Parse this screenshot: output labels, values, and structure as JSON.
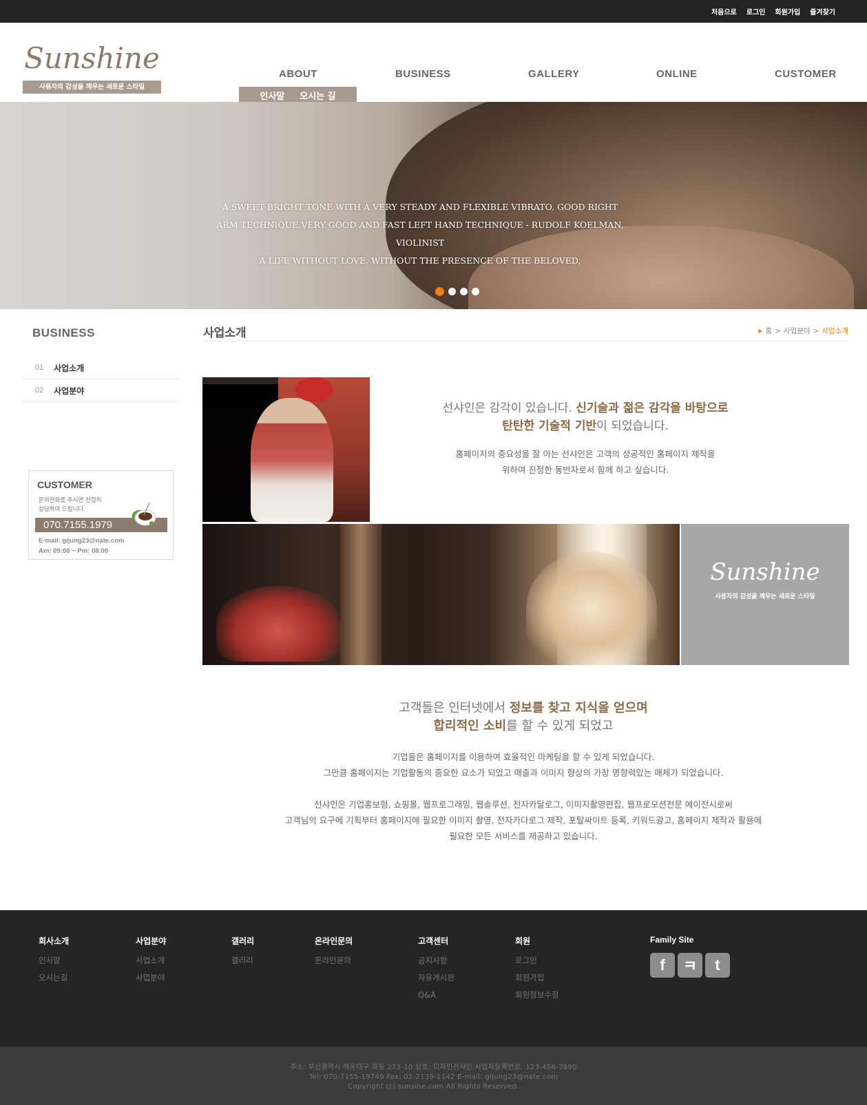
{
  "utility_links": [
    "처음으로",
    "로그인",
    "회원가입",
    "즐겨찾기"
  ],
  "logo": {
    "word": "Sunshine",
    "tagline": "사용자의 감성을 깨우는 새로운 스타일"
  },
  "gnb": {
    "about": "ABOUT",
    "business": "BUSINESS",
    "gallery": "GALLERY",
    "online": "ONLINE",
    "customer": "CUSTOMER"
  },
  "subnav": [
    "인사말",
    "오시는 길"
  ],
  "hero": {
    "lines": [
      "A SWEET BRIGHT TONE WITH A VERY STEADY AND FLEXIBLE VIBRATO, GOOD RIGHT",
      "ARM TECHNIQUE,VERY GOOD AND FAST LEFT HAND TECHNIQUE - RUDOLF KOELMAN, VIOLINIST",
      "A LIFE WITHOUT LOVE, WITHOUT THE PRESENCE OF THE BELOVED,"
    ],
    "slide_count": 4,
    "active_slide": 1
  },
  "sidebar": {
    "title": "BUSINESS",
    "items": [
      {
        "num": "01",
        "label": "사업소개"
      },
      {
        "num": "02",
        "label": "사업분야"
      }
    ]
  },
  "customer_box": {
    "title": "CUSTOMER",
    "desc_1": "문의전화를 주시면 친절히",
    "desc_2": "상담하여 드립니다.",
    "phone": "070.7155.1979",
    "email": "E-mail: gijung23@nate.com",
    "hours": "Am: 09:00 ~ Pm: 08:00"
  },
  "content": {
    "title": "사업소개",
    "breadcrumb": {
      "home": "홈",
      "sep": ">",
      "parent": "사업분야",
      "current": "사업소개"
    },
    "block_a": {
      "head_1_plain": "선샤인은 감각이 있습니다. ",
      "head_1_accent": "신기술과 젊은 감각을 바탕으로",
      "head_2_accent": "탄탄한 기술적 기반",
      "head_2_plain": "이 되었습니다.",
      "body_1": "홈페이지의 중요성을 잘 아는 선샤인은 고객의 성공적인 홈페이지 제작을",
      "body_2": "위하여 진정한 동반자로서 함께 하고 싶습니다."
    },
    "brand_box": {
      "word": "Sunshine",
      "tagline": "사용자의 감성을 깨우는 새로운 스타일"
    },
    "block_b": {
      "head_1_plain": "고객들은 인터넷에서 ",
      "head_1_accent": "정보를 찾고 지식을 얻으며",
      "head_2_accent": "합리적인 소비",
      "head_2_plain": "를 할 수 있게 되었고",
      "body_1": "기업들은 홈페이지를 이용하여 효율적인 마케팅을 할 수 있게 되었습니다.",
      "body_2": "그만큼 홈페이지는 기업활동의 중요한 요소가 되었고 매출과 이미지 향상의 가장 영향력있는 매체가 되었습니다.",
      "body_3": "선샤인은 기업홍보형, 쇼핑몰, 웹프로그래밍, 웹솔루션, 전자카달로그, 이미지촬영편집, 웹프로모션전문 에이전시로써",
      "body_4": "고객님의 요구에 기획부터 홈페이지에 필요한 이미지 촬영, 전자카다로그 제작, 포탈싸이트 등록, 키워드광고, 홈페이지 제작과 활용에",
      "body_5": "필요한 모든 서비스를 제공하고 있습니다."
    }
  },
  "footer": {
    "cols": [
      {
        "head": "회사소개",
        "links": [
          "인사말",
          "오시는길"
        ]
      },
      {
        "head": "사업분야",
        "links": [
          "사업소개",
          "사업분야"
        ]
      },
      {
        "head": "갤러리",
        "links": [
          "갤러리"
        ]
      },
      {
        "head": "온라인문의",
        "links": [
          "온라인문의"
        ]
      },
      {
        "head": "고객센터",
        "links": [
          "공지사항",
          "자유게시판",
          "Q&A"
        ]
      },
      {
        "head": "회원",
        "links": [
          "로그인",
          "회원가입",
          "회원정보수정"
        ]
      }
    ],
    "family_site": "Family Site",
    "sns": [
      {
        "icon": "facebook-icon",
        "glyph": "f"
      },
      {
        "icon": "cyworld-icon",
        "glyph": "ㅋ"
      },
      {
        "icon": "twitter-icon",
        "glyph": "t"
      }
    ],
    "address": "주소: 부산광역시 해운대구 좌동 273-10  상호: 디자인선샤인  사업자등록번호: 123-456-7890",
    "contact": "Tel: 070-7155-19749  Fax: 02-2139-1142  E-mail: gijung23@nate.com",
    "copyright": "Copyright (c) sunsine.com All Rights Reserved."
  },
  "colors": {
    "accent": "#f07d1a",
    "brand": "#a89a8e",
    "dark": "#252525"
  }
}
